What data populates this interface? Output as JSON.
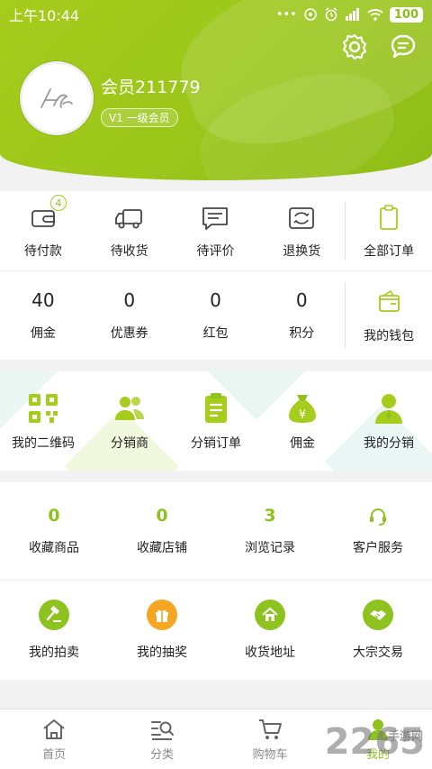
{
  "status_bar": {
    "time": "上午10:44",
    "icons": [
      "dots",
      "hotspot-icon",
      "alarm-icon",
      "signal-icon",
      "wifi-icon"
    ],
    "battery": "100"
  },
  "header": {
    "username": "会员211779",
    "level": "V1  一级会员",
    "settings_icon": "gear-icon",
    "message_icon": "chat-icon"
  },
  "orders": [
    {
      "label": "待付款",
      "icon": "wallet-icon",
      "badge": "4"
    },
    {
      "label": "待收货",
      "icon": "truck-icon"
    },
    {
      "label": "待评价",
      "icon": "comment-icon"
    },
    {
      "label": "退换货",
      "icon": "exchange-icon"
    },
    {
      "label": "全部订单",
      "icon": "clipboard-icon"
    }
  ],
  "wallet": [
    {
      "value": "40",
      "label": "佣金"
    },
    {
      "value": "0",
      "label": "优惠券"
    },
    {
      "value": "0",
      "label": "红包"
    },
    {
      "value": "0",
      "label": "积分"
    },
    {
      "label": "我的钱包",
      "icon": "wallet-icon"
    }
  ],
  "distribution": [
    {
      "label": "我的二维码",
      "icon": "qrcode-icon"
    },
    {
      "label": "分销商",
      "icon": "people-icon"
    },
    {
      "label": "分销订单",
      "icon": "clipboard-icon"
    },
    {
      "label": "佣金",
      "icon": "money-bag-icon"
    },
    {
      "label": "我的分销",
      "icon": "user-icon"
    }
  ],
  "favorites": [
    {
      "value": "0",
      "label": "收藏商品"
    },
    {
      "value": "0",
      "label": "收藏店铺"
    },
    {
      "value": "3",
      "label": "浏览记录"
    },
    {
      "label": "客户服务",
      "icon": "headset-icon"
    }
  ],
  "services": [
    {
      "label": "我的拍卖",
      "icon": "gavel-icon",
      "color": "#8dc21f"
    },
    {
      "label": "我的抽奖",
      "icon": "gift-icon",
      "color": "#f5a623"
    },
    {
      "label": "收货地址",
      "icon": "home-icon",
      "color": "#8dc21f"
    },
    {
      "label": "大宗交易",
      "icon": "handshake-icon",
      "color": "#8dc21f"
    }
  ],
  "tabbar": [
    {
      "label": "首页",
      "icon": "home-icon"
    },
    {
      "label": "分类",
      "icon": "category-search-icon"
    },
    {
      "label": "购物车",
      "icon": "cart-icon"
    },
    {
      "label": "我的",
      "icon": "user-icon",
      "active": true
    }
  ],
  "watermark": {
    "text": "2265",
    "sub": "手游网"
  },
  "colors": {
    "accent": "#8dc21f",
    "header": "#9bc61a",
    "orange": "#f5a623"
  }
}
